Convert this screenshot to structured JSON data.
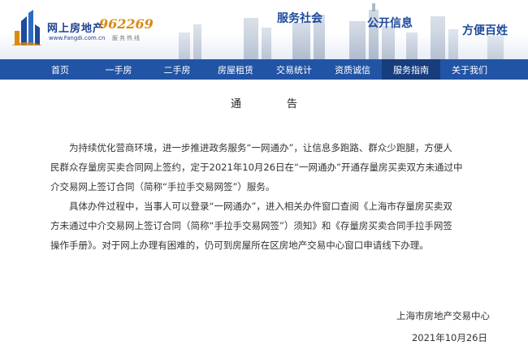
{
  "header": {
    "site_name": "网上房地产",
    "site_url": "www.Fangdi.com.cn",
    "hotline_number": "962269",
    "hotline_label": "服务热线",
    "slogans": [
      "服务社会",
      "公开信息",
      "方便百姓"
    ]
  },
  "nav": {
    "items": [
      {
        "label": "首页"
      },
      {
        "label": "一手房"
      },
      {
        "label": "二手房"
      },
      {
        "label": "房屋租赁"
      },
      {
        "label": "交易统计"
      },
      {
        "label": "资质诚信"
      },
      {
        "label": "服务指南"
      },
      {
        "label": "关于我们"
      }
    ],
    "active_index": 6
  },
  "notice": {
    "title": "通告",
    "paragraph1": [
      "为持续优化营商环境，进一步推进政务服务“一网通办”，让信息多跑路、群众少跑腿，方便人",
      "民群众存量房买卖合同网上签约，定于2021年10月26日在“一网通办”开通存量房买卖双方未通过中",
      "介交易网上签订合同（简称“手拉手交易网签”）服务。"
    ],
    "paragraph2": [
      "具体办件过程中，当事人可以登录“一网通办”，进入相关办件窗口查阅《上海市存量房买卖双",
      "方未通过中介交易网上签订合同（简称“手拉手交易网签”）须知》和《存量房买卖合同手拉手网签",
      "操作手册》。对于网上办理有困难的，仍可到房屋所在区房地产交易中心窗口申请线下办理。"
    ],
    "signature_org": "上海市房地产交易中心",
    "signature_date": "2021年10月26日"
  },
  "colors": {
    "nav_bg": "#2254a5",
    "nav_active": "#173d7d",
    "brand_blue": "#1c3f8f",
    "hotline_orange": "#d98a12"
  }
}
